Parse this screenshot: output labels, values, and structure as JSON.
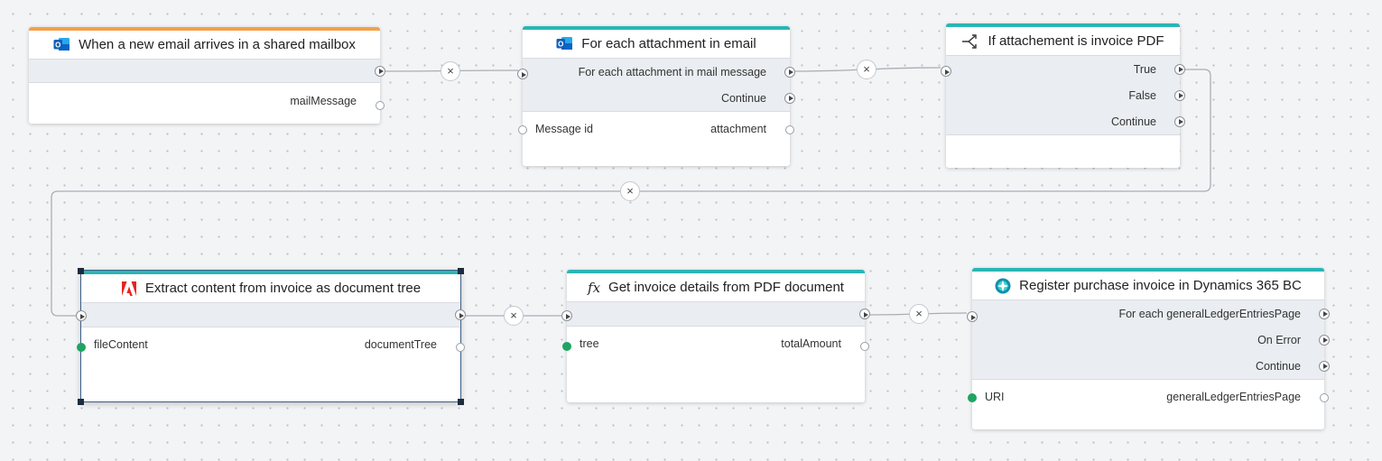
{
  "colors": {
    "canvas_bg": "#f3f4f6",
    "action_accent": "#2bb5b5",
    "trigger_accent": "#f4a14a",
    "input_connected": "#1fa463"
  },
  "nodes": [
    {
      "title": "When a new email arrives in a shared mailbox",
      "icon": "outlook-icon",
      "outputs": [],
      "inputs": [],
      "params_out": [
        "mailMessage"
      ]
    },
    {
      "title": "For each attachment in email",
      "icon": "outlook-icon",
      "outputs": [
        "For each attachment in mail message",
        "Continue"
      ],
      "params_in": [
        "Message id"
      ],
      "params_out": [
        "attachment"
      ]
    },
    {
      "title": "If attachement is invoice PDF",
      "icon": "branch-icon",
      "outputs": [
        "True",
        "False",
        "Continue"
      ]
    },
    {
      "title": "Extract content from invoice as document tree",
      "icon": "adobe-pdf-icon",
      "params_in": [
        "fileContent"
      ],
      "params_out": [
        "documentTree"
      ]
    },
    {
      "title": "Get invoice details from PDF document",
      "icon": "function-icon",
      "icon_text": "fx",
      "params_in": [
        "tree"
      ],
      "params_out": [
        "totalAmount"
      ]
    },
    {
      "title": "Register purchase invoice in Dynamics 365 BC",
      "icon": "dynamics-icon",
      "outputs": [
        "For each generalLedgerEntriesPage",
        "On Error",
        "Continue"
      ],
      "params_in": [
        "URI"
      ],
      "params_out": [
        "generalLedgerEntriesPage"
      ]
    }
  ],
  "connector_remove_symbol": "×"
}
